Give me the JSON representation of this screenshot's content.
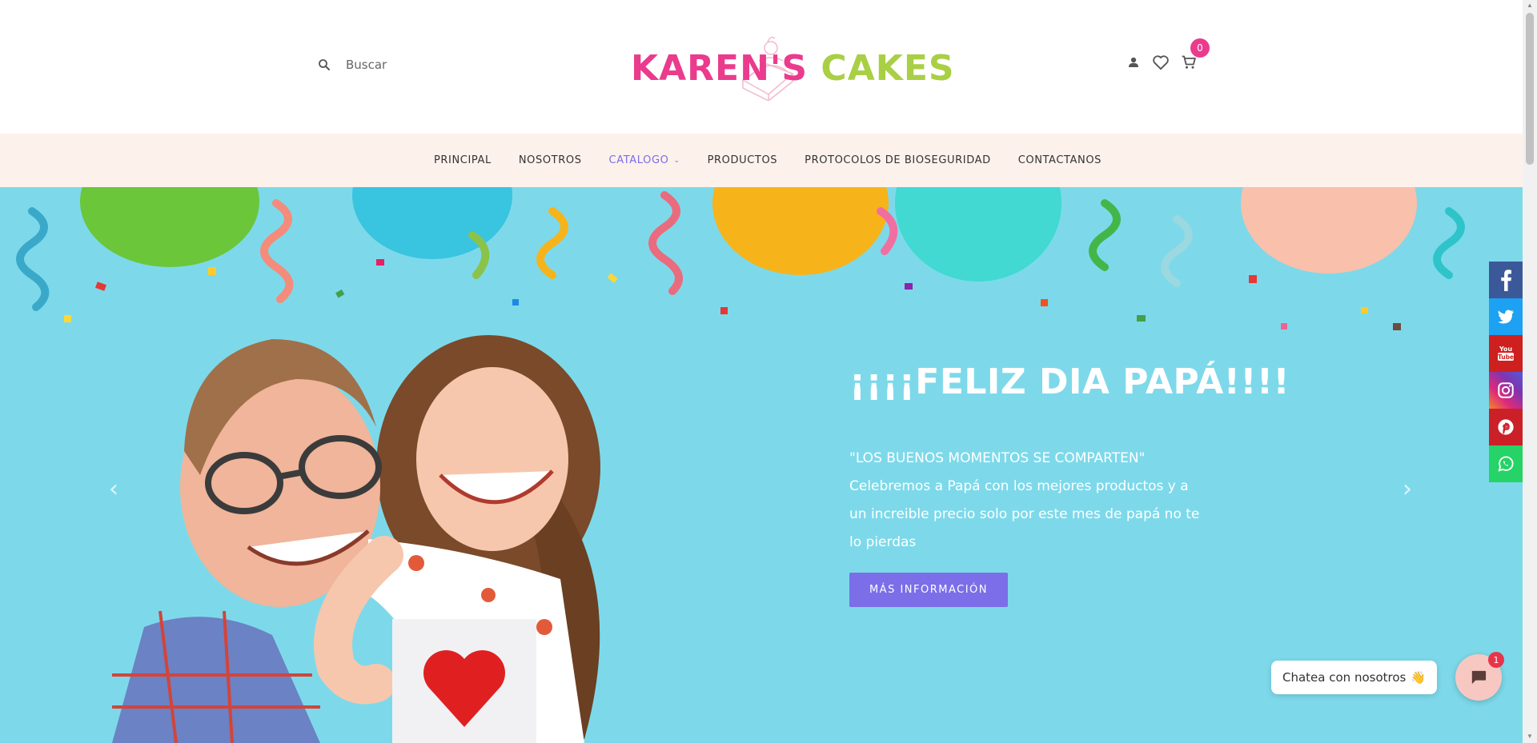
{
  "header": {
    "search": {
      "placeholder": "Buscar",
      "icon": "search-icon"
    },
    "logo": {
      "alt": "KAREN'S CAKES"
    },
    "icons": {
      "account": "user-icon",
      "wishlist": "heart-icon",
      "cart": "cart-icon"
    },
    "cart_count": "0"
  },
  "nav": {
    "items": [
      {
        "label": "PRINCIPAL"
      },
      {
        "label": "NOSOTROS"
      },
      {
        "label": "CATALOGO",
        "active": true
      },
      {
        "label": "PRODUCTOS"
      },
      {
        "label": "PROTOCOLOS DE BIOSEGURIDAD"
      },
      {
        "label": "CONTACTANOS"
      }
    ]
  },
  "hero": {
    "title": "¡¡¡¡FELIZ DIA PAPÁ!!!!",
    "subtitle": "\"LOS BUENOS MOMENTOS SE COMPARTEN\" Celebremos a Papá con los mejores productos y a un increible precio solo por este mes de papá no te lo pierdas",
    "button": "MÁS INFORMACIÓN",
    "prev": "‹",
    "next": "›"
  },
  "social": [
    "facebook-icon",
    "twitter-icon",
    "youtube-icon",
    "instagram-icon",
    "pinterest-icon",
    "whatsapp-icon"
  ],
  "chat": {
    "label": "Chatea con nosotros",
    "emoji": "👋",
    "badge": "1"
  },
  "colors": {
    "accent": "#7b6ee8",
    "pink": "#ea3b8d",
    "green": "#a9cf44",
    "hero_bg": "#7dd9ea",
    "nav_bg": "#fdf1ec"
  }
}
